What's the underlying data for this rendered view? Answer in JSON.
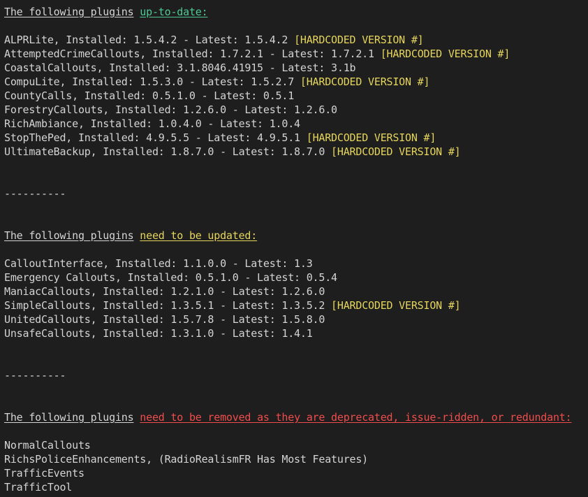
{
  "colors": {
    "background": "#1e1e1e",
    "text": "#d4d4d4",
    "up_to_date": "#4ec994",
    "need_update": "#e5d55b",
    "remove": "#f14c4c",
    "tag": "#e5d55b"
  },
  "sections": {
    "up_to_date": {
      "prefix": "The following plugins",
      "highlight": "up-to-date:",
      "items": [
        {
          "text": "ALPRLite, Installed: 1.5.4.2 - Latest: 1.5.4.2",
          "tag": "[HARDCODED VERSION #]"
        },
        {
          "text": "AttemptedCrimeCallouts, Installed: 1.7.2.1 - Latest: 1.7.2.1",
          "tag": "[HARDCODED VERSION #]"
        },
        {
          "text": "CoastalCallouts, Installed: 3.1.8046.41915 - Latest: 3.1b",
          "tag": ""
        },
        {
          "text": "CompuLite, Installed: 1.5.3.0 - Latest: 1.5.2.7",
          "tag": "[HARDCODED VERSION #]"
        },
        {
          "text": "CountyCalls, Installed: 0.5.1.0 - Latest: 0.5.1",
          "tag": ""
        },
        {
          "text": "ForestryCallouts, Installed: 1.2.6.0 - Latest: 1.2.6.0",
          "tag": ""
        },
        {
          "text": "RichAmbiance, Installed: 1.0.4.0 - Latest: 1.0.4",
          "tag": ""
        },
        {
          "text": "StopThePed, Installed: 4.9.5.5 - Latest: 4.9.5.1",
          "tag": "[HARDCODED VERSION #]"
        },
        {
          "text": "UltimateBackup, Installed: 1.8.7.0 - Latest: 1.8.7.0",
          "tag": "[HARDCODED VERSION #]"
        }
      ]
    },
    "separator": "----------",
    "need_update": {
      "prefix": "The following plugins",
      "highlight": "need to be updated:",
      "items": [
        {
          "text": "CalloutInterface, Installed: 1.1.0.0 - Latest: 1.3",
          "tag": ""
        },
        {
          "text": "Emergency Callouts, Installed: 0.5.1.0 - Latest: 0.5.4",
          "tag": ""
        },
        {
          "text": "ManiacCallouts, Installed: 1.2.1.0 - Latest: 1.2.6.0",
          "tag": ""
        },
        {
          "text": "SimpleCallouts, Installed: 1.3.5.1 - Latest: 1.3.5.2",
          "tag": "[HARDCODED VERSION #]"
        },
        {
          "text": "UnitedCallouts, Installed: 1.5.7.8 - Latest: 1.5.8.0",
          "tag": ""
        },
        {
          "text": "UnsafeCallouts, Installed: 1.3.1.0 - Latest: 1.4.1",
          "tag": ""
        }
      ]
    },
    "remove": {
      "prefix": "The following plugins",
      "highlight": "need to be removed as they are deprecated, issue-ridden, or redundant:",
      "items": [
        {
          "text": "NormalCallouts",
          "tag": ""
        },
        {
          "text": "RichsPoliceEnhancements, (RadioRealismFR Has Most Features)",
          "tag": ""
        },
        {
          "text": "TrafficEvents",
          "tag": ""
        },
        {
          "text": "TrafficTool",
          "tag": ""
        }
      ]
    }
  }
}
